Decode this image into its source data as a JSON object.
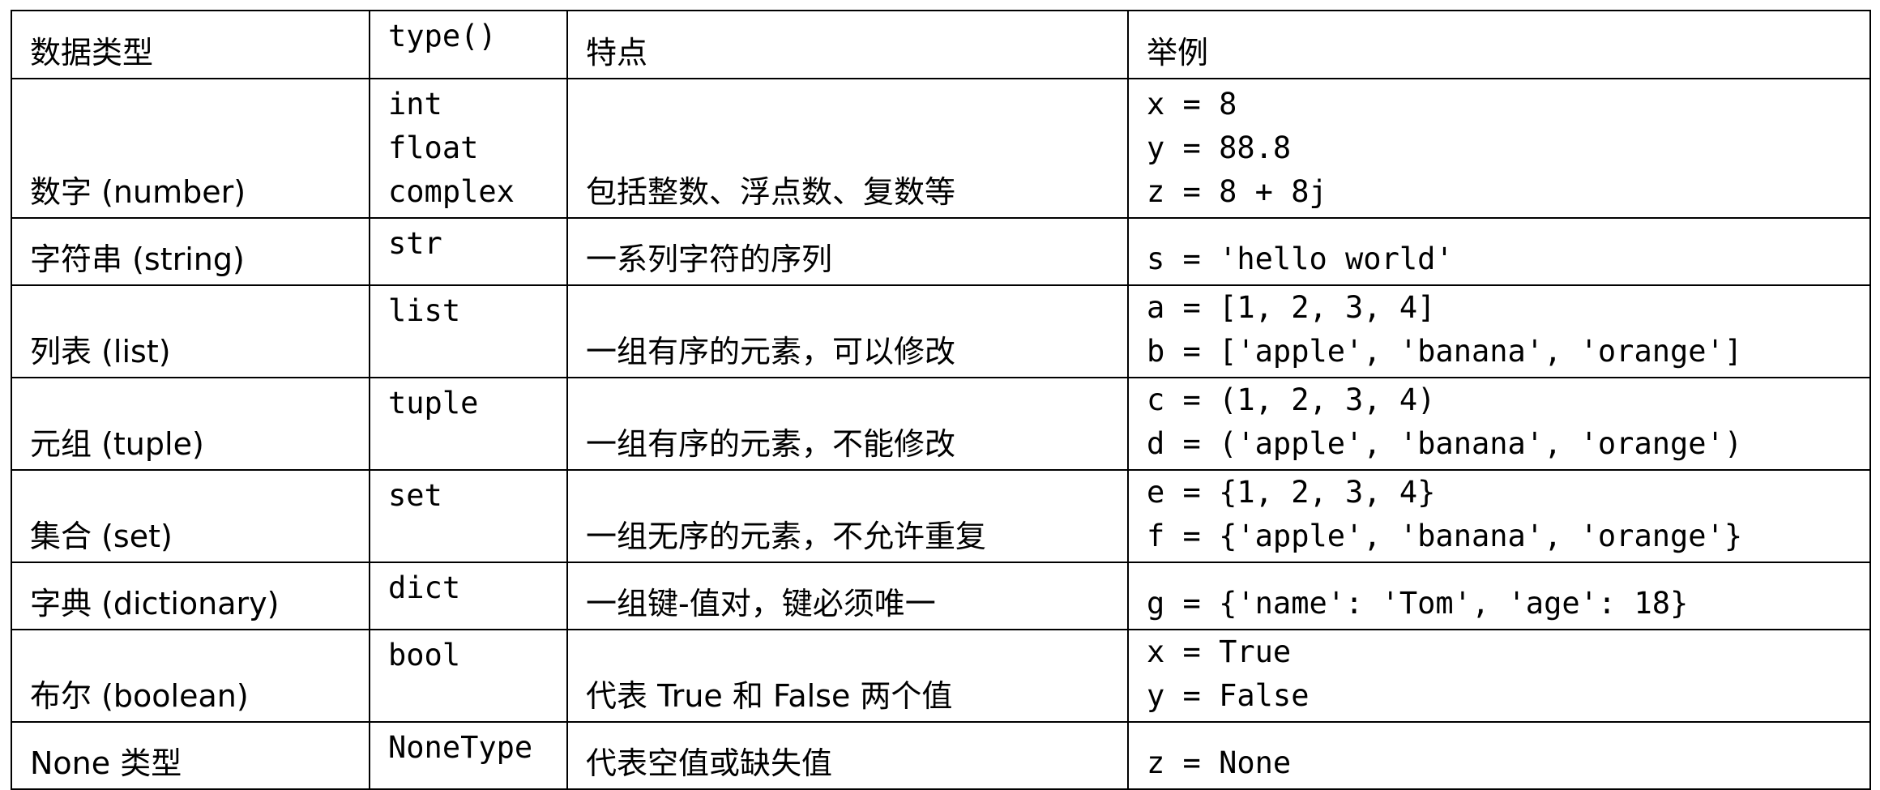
{
  "table": {
    "headers": [
      "数据类型",
      "type()",
      "特点",
      "举例"
    ],
    "rows": [
      {
        "type_name": "数字 (number)",
        "type_funcs": [
          "int",
          "float",
          "complex"
        ],
        "feature": "包括整数、浮点数、复数等",
        "examples": [
          "x = 8",
          "y = 88.8",
          "z = 8 + 8j"
        ]
      },
      {
        "type_name": "字符串 (string)",
        "type_funcs": [
          "str"
        ],
        "feature": "一系列字符的序列",
        "examples": [
          "s = 'hello world'"
        ]
      },
      {
        "type_name": "列表 (list)",
        "type_funcs": [
          "list"
        ],
        "feature": "一组有序的元素，可以修改",
        "examples": [
          "a = [1, 2, 3, 4]",
          "b = ['apple', 'banana', 'orange']"
        ]
      },
      {
        "type_name": "元组 (tuple)",
        "type_funcs": [
          "tuple"
        ],
        "feature": "一组有序的元素，不能修改",
        "examples": [
          "c = (1, 2, 3, 4)",
          "d = ('apple', 'banana', 'orange')"
        ]
      },
      {
        "type_name": "集合 (set)",
        "type_funcs": [
          "set"
        ],
        "feature": "一组无序的元素，不允许重复",
        "examples": [
          "e = {1, 2, 3, 4}",
          "f = {'apple', 'banana', 'orange'}"
        ]
      },
      {
        "type_name": "字典 (dictionary)",
        "type_funcs": [
          "dict"
        ],
        "feature": "一组键-值对，键必须唯一",
        "examples": [
          "g = {'name': 'Tom', 'age': 18}"
        ]
      },
      {
        "type_name": "布尔 (boolean)",
        "type_funcs": [
          "bool"
        ],
        "feature": "代表 True 和 False 两个值",
        "examples": [
          "x = True",
          "y = False"
        ]
      },
      {
        "type_name": "None 类型",
        "type_funcs": [
          "NoneType"
        ],
        "feature": "代表空值或缺失值",
        "examples": [
          "z = None"
        ]
      }
    ]
  }
}
